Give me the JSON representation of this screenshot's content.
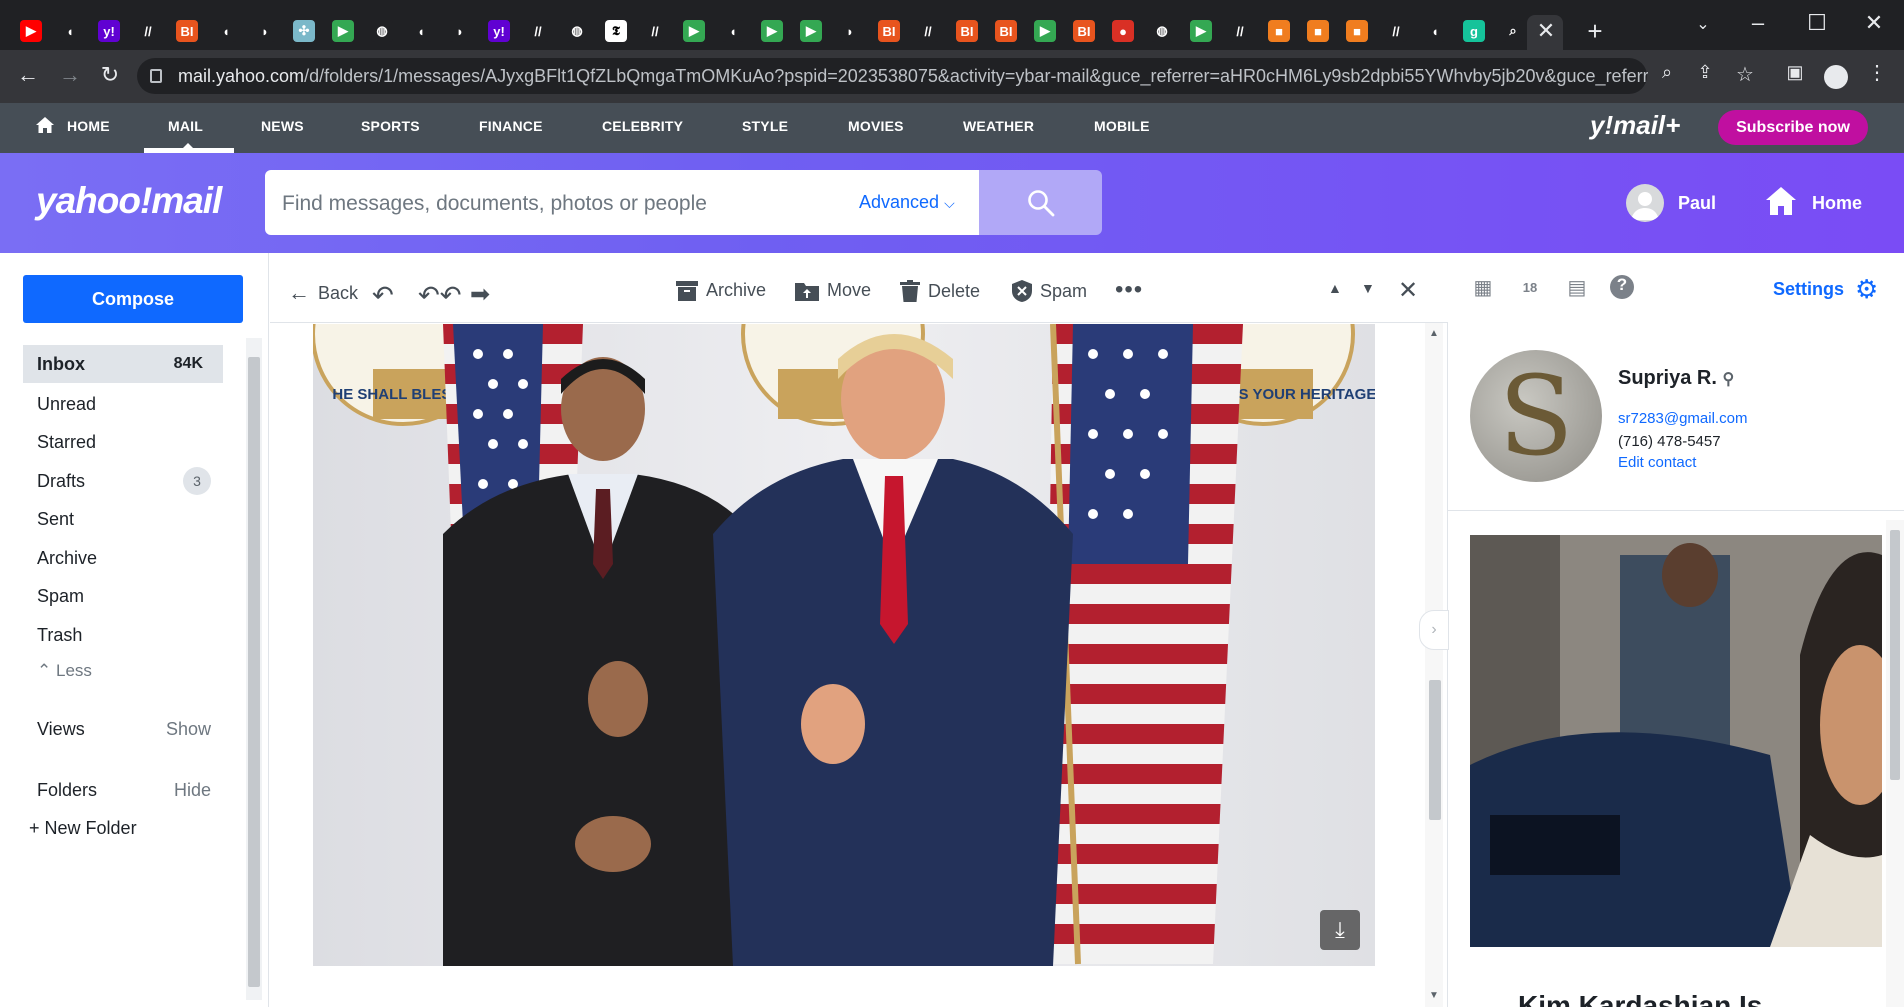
{
  "browser": {
    "url_host": "mail.yahoo.com",
    "url_path": "/d/folders/1/messages/AJyxgBFlt1QfZLbQmgaTmOMKuAo?pspid=2023538075&activity=ybar-mail&guce_referrer=aHR0cHM6Ly9sb2dpbi55YWhvby5jb20v&guce_referrer_s...",
    "tab_favicons": [
      "youtube-icon",
      "shield-icon",
      "yahoo-icon",
      "wsj-icon",
      "bi-icon",
      "shield-icon",
      "arrow-icon",
      "puzzle-icon",
      "play-icon",
      "globe-icon",
      "shield-icon",
      "arrow-icon",
      "yahoo-icon",
      "wsj-icon",
      "globe-icon",
      "nyt-icon",
      "wsj-icon",
      "play-icon",
      "shield-icon",
      "play-icon",
      "play-icon",
      "arrow-icon",
      "bi-icon",
      "wsj-icon",
      "bi-icon",
      "bi-icon",
      "play-icon",
      "bi-icon",
      "pin-icon",
      "globe-icon",
      "play-icon",
      "wsj-icon",
      "bookmark-icon",
      "bookmark-icon",
      "bookmark-icon",
      "wsj-icon",
      "shield-icon",
      "grammarly-icon",
      "search-icon"
    ]
  },
  "ynav": {
    "items": [
      "HOME",
      "MAIL",
      "NEWS",
      "SPORTS",
      "FINANCE",
      "CELEBRITY",
      "STYLE",
      "MOVIES",
      "WEATHER",
      "MOBILE"
    ],
    "mail_plus_logo": "y!mail+",
    "subscribe": "Subscribe now"
  },
  "header": {
    "logo": "yahoo!mail",
    "search_placeholder": "Find messages, documents, photos or people",
    "advanced": "Advanced",
    "user": "Paul",
    "home": "Home"
  },
  "sidebar": {
    "compose": "Compose",
    "folders": [
      {
        "label": "Inbox",
        "count": "84K"
      },
      {
        "label": "Unread",
        "count": ""
      },
      {
        "label": "Starred",
        "count": ""
      },
      {
        "label": "Drafts",
        "count": "3"
      },
      {
        "label": "Sent",
        "count": ""
      },
      {
        "label": "Archive",
        "count": ""
      },
      {
        "label": "Spam",
        "count": ""
      },
      {
        "label": "Trash",
        "count": ""
      }
    ],
    "less": "Less",
    "views": "Views",
    "views_action": "Show",
    "folders_label": "Folders",
    "folders_action": "Hide",
    "new_folder": "New Folder"
  },
  "toolbar": {
    "back": "Back",
    "archive": "Archive",
    "move": "Move",
    "delete": "Delete",
    "spam": "Spam"
  },
  "message": {
    "banner_text_left": "HE SHALL BLESS YOUR HE",
    "banner_text_right": "HE SHALL BLESS YOUR HERITAGE"
  },
  "right_pane": {
    "settings": "Settings",
    "contact": {
      "name": "Supriya R.",
      "email": "sr7283@gmail.com",
      "phone": "(716) 478-5457",
      "edit": "Edit contact",
      "monogram": "S"
    },
    "ad_title": "Kim Kardashian Is"
  },
  "colors": {
    "accent": "#0f69ff",
    "subscribe": "#c00fa0",
    "nav_bg": "#464e56",
    "header_purple": "#7a6ef4"
  }
}
